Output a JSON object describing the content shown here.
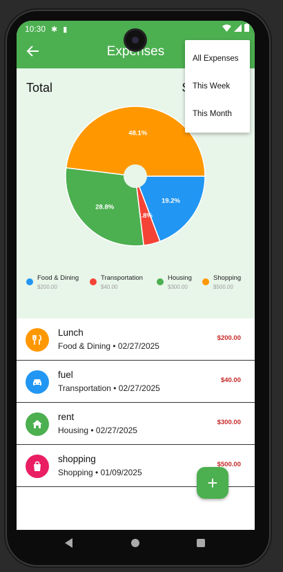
{
  "status_bar": {
    "time": "10:30"
  },
  "app_bar": {
    "title": "Expenses"
  },
  "summary": {
    "total_label": "Total",
    "total_amount_partial": "$"
  },
  "menu": {
    "items": [
      "All Expenses",
      "This Week",
      "This Month"
    ]
  },
  "chart_data": {
    "type": "pie",
    "slices": [
      {
        "name": "Food & Dining",
        "value": 200.0,
        "percent_label": "19.2%",
        "color": "#2196f3"
      },
      {
        "name": "Transportation",
        "value": 40.0,
        "percent_label": "3.8%",
        "color": "#f44336"
      },
      {
        "name": "Housing",
        "value": 300.0,
        "percent_label": "28.8%",
        "color": "#4caf50"
      },
      {
        "name": "Shopping",
        "value": 500.0,
        "percent_label": "48.1%",
        "color": "#ff9800"
      }
    ],
    "legend": [
      {
        "name": "Food & Dining",
        "amount": "$200.00",
        "color": "#2196f3"
      },
      {
        "name": "Transportation",
        "amount": "$40.00",
        "color": "#f44336"
      },
      {
        "name": "Housing",
        "amount": "$300.00",
        "color": "#4caf50"
      },
      {
        "name": "Shopping",
        "amount": "$500.00",
        "color": "#ff9800"
      }
    ]
  },
  "expenses": [
    {
      "name": "Lunch",
      "subtitle": "Food & Dining • 02/27/2025",
      "amount": "$200.00",
      "icon": "fork-knife-icon",
      "color": "#ff9800"
    },
    {
      "name": "fuel",
      "subtitle": "Transportation • 02/27/2025",
      "amount": "$40.00",
      "icon": "car-icon",
      "color": "#2196f3"
    },
    {
      "name": "rent",
      "subtitle": "Housing • 02/27/2025",
      "amount": "$300.00",
      "icon": "home-icon",
      "color": "#4caf50"
    },
    {
      "name": "shopping",
      "subtitle": "Shopping • 01/09/2025",
      "amount": "$500.00",
      "icon": "shopping-bag-icon",
      "color": "#e91e63"
    }
  ],
  "fab": {
    "label": "+"
  }
}
